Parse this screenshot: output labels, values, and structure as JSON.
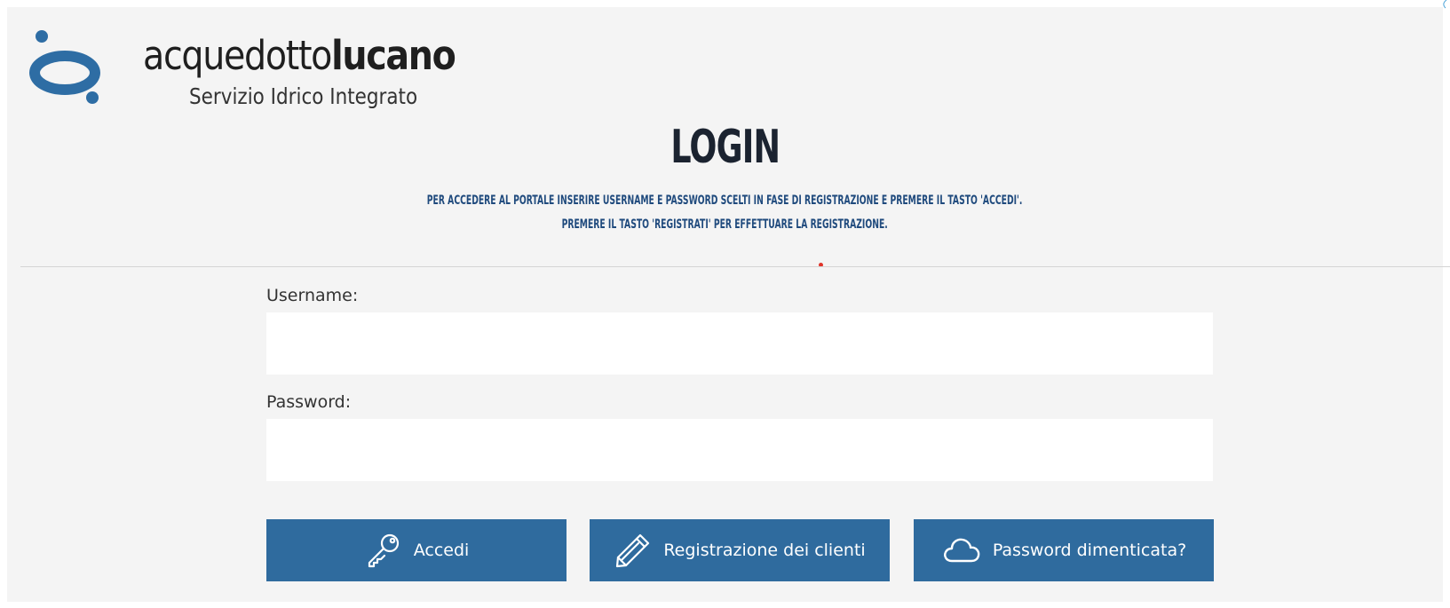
{
  "logo": {
    "brand_light": "acquedotto",
    "brand_bold": "lucano",
    "tagline": "Servizio Idrico Integrato"
  },
  "page": {
    "title": "LOGIN",
    "instructions_line1": "PER ACCEDERE AL PORTALE INSERIRE USERNAME E PASSWORD SCELTI IN FASE DI REGISTRAZIONE E PREMERE IL TASTO 'ACCEDI'.",
    "instructions_line2": "PREMERE IL TASTO 'REGISTRATI' PER EFFETTUARE LA REGISTRAZIONE."
  },
  "form": {
    "username_label": "Username:",
    "username_value": "",
    "password_label": "Password:",
    "password_value": ""
  },
  "buttons": {
    "login_label": "Accedi",
    "register_label": "Registrazione dei clienti",
    "forgot_label": "Password dimenticata?"
  },
  "icons": {
    "login": "key-icon",
    "register": "pencil-icon",
    "forgot": "cloud-icon"
  },
  "colors": {
    "button_bg": "#2f6b9e",
    "logo_blue": "#2e6da4",
    "title": "#1b2330",
    "instructions": "#1f4a7d",
    "panel_bg": "#f4f4f4"
  }
}
